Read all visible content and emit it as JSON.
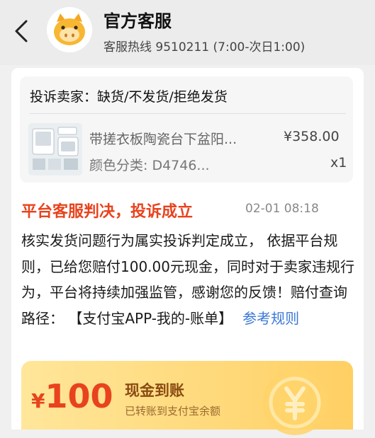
{
  "header": {
    "back_icon": "chevron-left-icon",
    "avatar_icon": "mascot-avatar-icon",
    "title": "官方客服",
    "subtitle": "客服热线 9510211 (7:00-次日1:00)"
  },
  "order": {
    "heading": "投诉卖家：缺货/不发货/拒绝发货",
    "product_name": "带搓衣板陶瓷台下盆阳...",
    "price": "¥358.00",
    "spec": "颜色分类: D4746...",
    "quantity": "x1"
  },
  "verdict": {
    "title": "平台客服判决，投诉成立",
    "time": "02-01 08:18",
    "body": "核实发货问题行为属实投诉判定成立， 依据平台规则，已给您赔付100.00元现金，同时对于卖家违规行为，平台将持续加强监管，感谢您的反馈！赔付查询路径： 【支付宝APP-我的-账单】",
    "link": "参考规则"
  },
  "payout": {
    "currency": "¥",
    "amount": "100",
    "title": "现金到账",
    "subtitle": "已转账到支付宝余额",
    "coin_icon": "yuan-coin-icon"
  },
  "colors": {
    "accent_red": "#e8431e",
    "link_blue": "#3b78d8",
    "payout_gold": "#ffd97a"
  }
}
